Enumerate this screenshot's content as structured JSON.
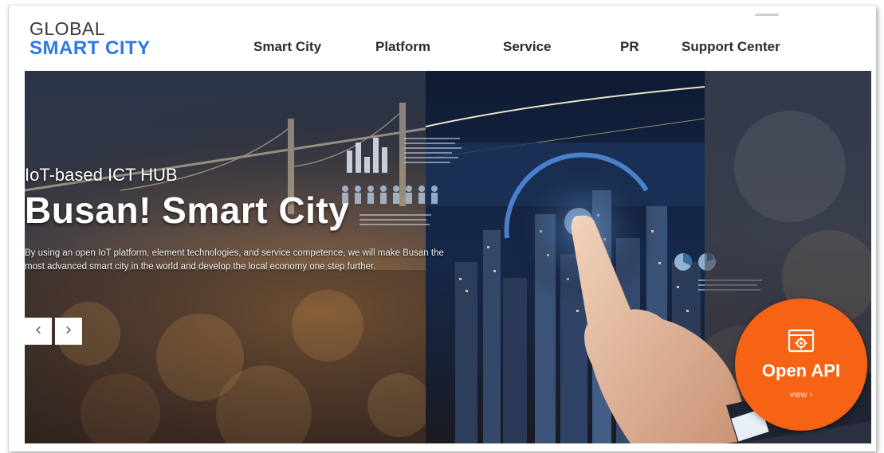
{
  "logo": {
    "line1": "GLOBAL",
    "line2": "SMART CITY"
  },
  "nav": {
    "items": [
      {
        "label": "Smart City"
      },
      {
        "label": "Platform"
      },
      {
        "label": "Service"
      },
      {
        "label": "PR"
      },
      {
        "label": "Support Center"
      }
    ]
  },
  "hero": {
    "subtitle": "IoT-based ICT HUB",
    "title": "Busan! Smart City",
    "description": "By using an open IoT platform, element technologies, and service competence, we will make Busan the most advanced smart city in the world and develop the local economy one step further.",
    "prev_arrow": "‹",
    "next_arrow": "›"
  },
  "open_api": {
    "label": "Open API",
    "view": "view ›",
    "color": "#f76314"
  },
  "colors": {
    "brand_blue": "#2b78e4",
    "nav_text": "#2b2b2b"
  }
}
